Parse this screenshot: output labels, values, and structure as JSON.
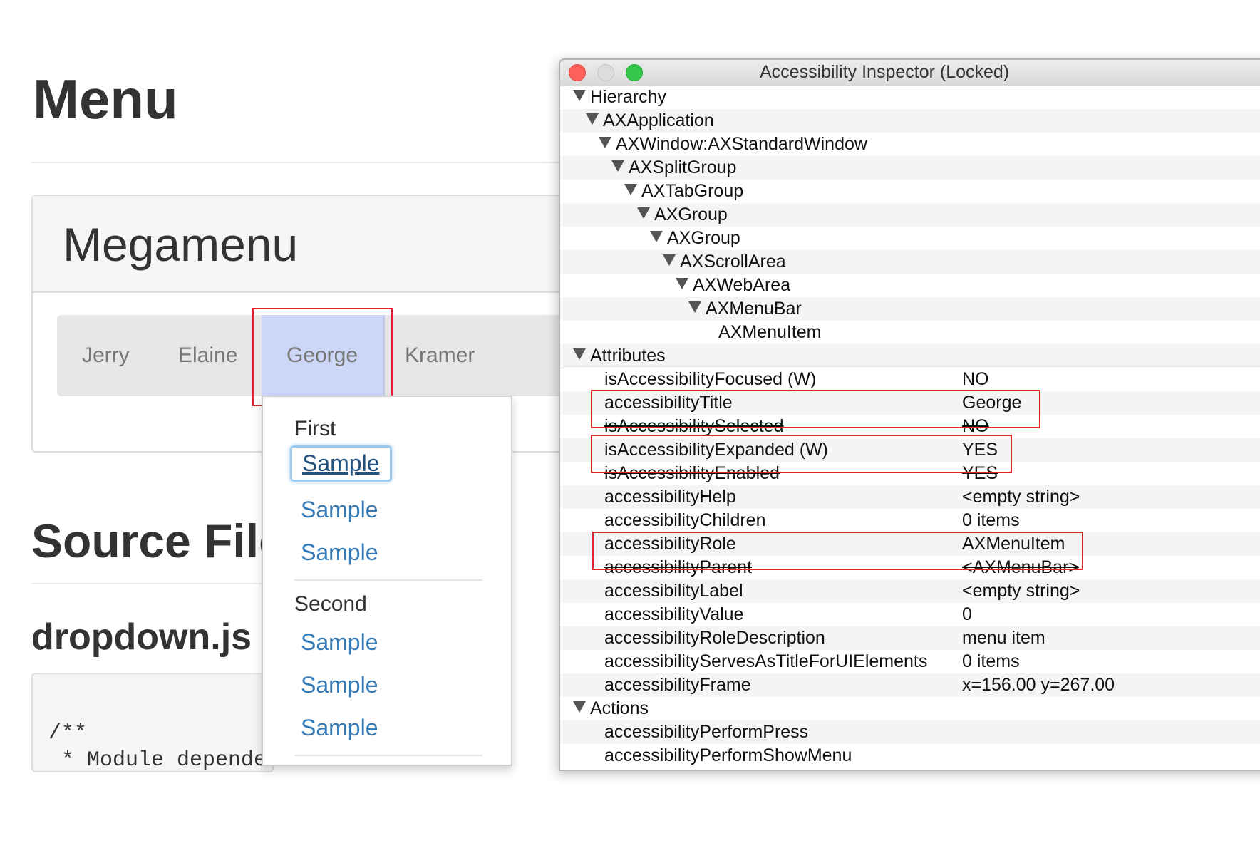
{
  "page": {
    "title": "Menu",
    "panel_title": "Megamenu",
    "menu_items": [
      "Jerry",
      "Elaine",
      "George",
      "Kramer"
    ],
    "dropdown": {
      "first_header": "First",
      "first_links": [
        "Sample",
        "Sample",
        "Sample"
      ],
      "second_header": "Second",
      "second_links": [
        "Sample",
        "Sample",
        "Sample"
      ]
    },
    "section_title": "Source File",
    "file_title": "dropdown.js",
    "code_lines": [
      "/**",
      " * Module dependen"
    ]
  },
  "inspector": {
    "title": "Accessibility Inspector (Locked)",
    "hierarchy_header": "Hierarchy",
    "hierarchy": [
      "AXApplication",
      "AXWindow:AXStandardWindow",
      "AXSplitGroup",
      "AXTabGroup",
      "AXGroup",
      "AXGroup",
      "AXScrollArea",
      "AXWebArea",
      "AXMenuBar",
      "AXMenuItem"
    ],
    "attributes_header": "Attributes",
    "attributes": [
      {
        "name": "isAccessibilityFocused (W)",
        "value": "NO"
      },
      {
        "name": "accessibilityTitle",
        "value": "George"
      },
      {
        "name": "isAccessibilitySelected",
        "value": "NO"
      },
      {
        "name": "isAccessibilityExpanded (W)",
        "value": "YES"
      },
      {
        "name": "isAccessibilityEnabled",
        "value": "YES"
      },
      {
        "name": "accessibilityHelp",
        "value": "<empty string>"
      },
      {
        "name": "accessibilityChildren",
        "value": "0 items"
      },
      {
        "name": "accessibilityRole",
        "value": "AXMenuItem"
      },
      {
        "name": "accessibilityParent",
        "value": "<AXMenuBar>"
      },
      {
        "name": "accessibilityLabel",
        "value": "<empty string>"
      },
      {
        "name": "accessibilityValue",
        "value": "0"
      },
      {
        "name": "accessibilityRoleDescription",
        "value": "menu item"
      },
      {
        "name": "accessibilityServesAsTitleForUIElements",
        "value": "0 items"
      },
      {
        "name": "accessibilityFrame",
        "value": "x=156.00 y=267.00"
      }
    ],
    "actions_header": "Actions",
    "actions": [
      "accessibilityPerformPress",
      "accessibilityPerformShowMenu"
    ]
  },
  "colors": {
    "highlight_box": "#e0232b",
    "active_menu_item": "#ccd6f7",
    "link": "#337ab7"
  }
}
